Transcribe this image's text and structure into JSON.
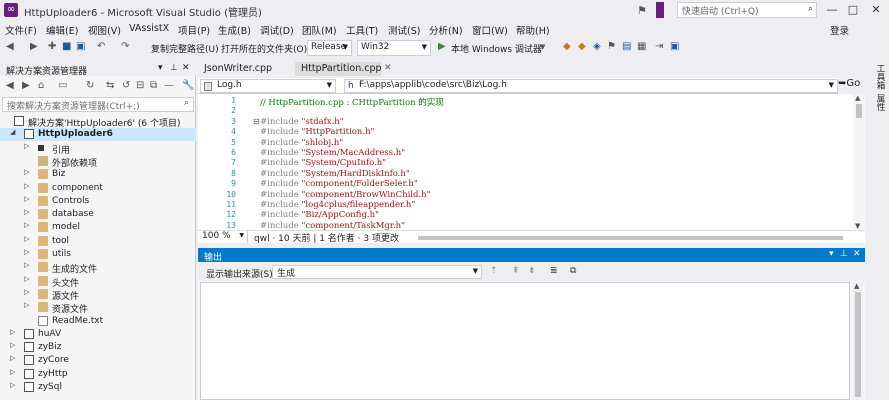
{
  "window": {
    "title": "HttpUploader6 - Microsoft Visual Studio (管理员)",
    "quick_launch_placeholder": "快速启动 (Ctrl+Q)",
    "minimize": "—",
    "restore": "□",
    "close": "✕"
  },
  "menu": [
    "文件(F)",
    "编辑(E)",
    "视图(V)",
    "VAssistX",
    "项目(P)",
    "生成(B)",
    "调试(D)",
    "团队(M)",
    "工具(T)",
    "测试(S)",
    "分析(N)",
    "窗口(W)",
    "帮助(H)"
  ],
  "login": "登录",
  "toolbar": {
    "copy_path": "复制完整路径(U)",
    "open_folder": "打开所在的文件夹(O)",
    "config": "Release",
    "platform": "Win32",
    "run": "本地 Windows 调试器"
  },
  "solution_explorer": {
    "title": "解决方案资源管理器",
    "search_placeholder": "搜索解决方案资源管理器(Ctrl+;)",
    "items": [
      {
        "label": "解决方案'HttpUploader6' (6 个项目)",
        "kind": "solution",
        "depth": 0,
        "expander": "",
        "selected": false
      },
      {
        "label": "HttpUploader6",
        "kind": "proj",
        "depth": 0,
        "expander": "◢",
        "selected": true
      },
      {
        "label": "引用",
        "kind": "ref",
        "depth": 1,
        "expander": "▷",
        "selected": false
      },
      {
        "label": "外部依赖项",
        "kind": "ext",
        "depth": 1,
        "expander": "",
        "selected": false
      },
      {
        "label": "Biz",
        "kind": "folder",
        "depth": 1,
        "expander": "▷",
        "selected": false
      },
      {
        "label": "component",
        "kind": "folder",
        "depth": 1,
        "expander": "▷",
        "selected": false
      },
      {
        "label": "Controls",
        "kind": "folder",
        "depth": 1,
        "expander": "▷",
        "selected": false
      },
      {
        "label": "database",
        "kind": "folder",
        "depth": 1,
        "expander": "▷",
        "selected": false
      },
      {
        "label": "model",
        "kind": "folder",
        "depth": 1,
        "expander": "▷",
        "selected": false
      },
      {
        "label": "tool",
        "kind": "folder",
        "depth": 1,
        "expander": "▷",
        "selected": false
      },
      {
        "label": "utils",
        "kind": "folder",
        "depth": 1,
        "expander": "▷",
        "selected": false
      },
      {
        "label": "生成的文件",
        "kind": "folder",
        "depth": 1,
        "expander": "▷",
        "selected": false
      },
      {
        "label": "头文件",
        "kind": "folder",
        "depth": 1,
        "expander": "▷",
        "selected": false
      },
      {
        "label": "源文件",
        "kind": "folder",
        "depth": 1,
        "expander": "▷",
        "selected": false
      },
      {
        "label": "资源文件",
        "kind": "folder",
        "depth": 1,
        "expander": "▷",
        "selected": false
      },
      {
        "label": "ReadMe.txt",
        "kind": "file",
        "depth": 1,
        "expander": "",
        "selected": false
      },
      {
        "label": "huAV",
        "kind": "proj",
        "depth": 0,
        "expander": "▷",
        "selected": false
      },
      {
        "label": "zyBiz",
        "kind": "proj",
        "depth": 0,
        "expander": "▷",
        "selected": false
      },
      {
        "label": "zyCore",
        "kind": "proj",
        "depth": 0,
        "expander": "▷",
        "selected": false
      },
      {
        "label": "zyHttp",
        "kind": "proj",
        "depth": 0,
        "expander": "▷",
        "selected": false
      },
      {
        "label": "zySql",
        "kind": "proj",
        "depth": 0,
        "expander": "▷",
        "selected": false
      }
    ]
  },
  "tabs": [
    {
      "label": "JsonWriter.cpp",
      "active": false
    },
    {
      "label": "HttpPartition.cpp",
      "active": true
    }
  ],
  "navbar": {
    "file": "Log.h",
    "path": "F:\\apps\\applib\\code\\src\\Biz\\Log.h",
    "go": "Go"
  },
  "code": {
    "lines": [
      {
        "n": "1",
        "parts": [
          {
            "t": "// HttpPartition.cpp : CHttpPartition 的实现",
            "c": "cmt"
          }
        ]
      },
      {
        "n": "2",
        "parts": []
      },
      {
        "n": "3",
        "parts": [
          {
            "t": "#include ",
            "c": "pp"
          },
          {
            "t": "\"stdafx.h\"",
            "c": "str"
          }
        ],
        "fold": "⊟"
      },
      {
        "n": "4",
        "parts": [
          {
            "t": "#include ",
            "c": "pp"
          },
          {
            "t": "\"HttpPartition.h\"",
            "c": "str"
          }
        ]
      },
      {
        "n": "5",
        "parts": [
          {
            "t": "#include ",
            "c": "pp"
          },
          {
            "t": "\"shlobj.h\"",
            "c": "str"
          }
        ]
      },
      {
        "n": "6",
        "parts": [
          {
            "t": "#include ",
            "c": "pp"
          },
          {
            "t": "\"System/MacAddress.h\"",
            "c": "str"
          }
        ]
      },
      {
        "n": "7",
        "parts": [
          {
            "t": "#include ",
            "c": "pp"
          },
          {
            "t": "\"System/CpuInfo.h\"",
            "c": "str"
          }
        ]
      },
      {
        "n": "8",
        "parts": [
          {
            "t": "#include ",
            "c": "pp"
          },
          {
            "t": "\"System/HardDiskInfo.h\"",
            "c": "str"
          }
        ]
      },
      {
        "n": "9",
        "parts": [
          {
            "t": "#include ",
            "c": "pp"
          },
          {
            "t": "\"component/FolderSeler.h\"",
            "c": "str"
          }
        ]
      },
      {
        "n": "10",
        "parts": [
          {
            "t": "#include ",
            "c": "pp"
          },
          {
            "t": "\"component/BrowWinChild.h\"",
            "c": "str"
          }
        ]
      },
      {
        "n": "11",
        "parts": [
          {
            "t": "#include ",
            "c": "pp"
          },
          {
            "t": "\"log4cplus/fileappender.h\"",
            "c": "str"
          }
        ]
      },
      {
        "n": "12",
        "parts": [
          {
            "t": "#include ",
            "c": "pp"
          },
          {
            "t": "\"Biz/AppConfig.h\"",
            "c": "str"
          }
        ]
      },
      {
        "n": "13",
        "parts": [
          {
            "t": "#include ",
            "c": "pp"
          },
          {
            "t": "\"component/TaskMgr.h\"",
            "c": "str"
          }
        ]
      }
    ]
  },
  "editor_status": {
    "zoom": "100 %",
    "position": "qwl · 10 天前 | 1 名作者 · 3 项更改"
  },
  "output": {
    "title": "输出",
    "source_label": "显示输出来源(S):",
    "source_value": "生成"
  },
  "right_strip": [
    "工具箱",
    "属性"
  ]
}
